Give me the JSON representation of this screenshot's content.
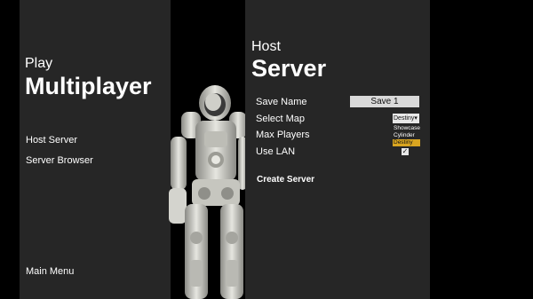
{
  "play_menu": {
    "eyebrow": "Play",
    "title": "Multiplayer",
    "items": [
      {
        "label": "Host Server"
      },
      {
        "label": "Server Browser"
      }
    ],
    "main_menu_label": "Main Menu"
  },
  "host_panel": {
    "eyebrow": "Host",
    "title": "Server",
    "settings": {
      "save_name_label": "Save Name",
      "save_name_value": "Save 1",
      "select_map_label": "Select Map",
      "select_map_value": "Destiny",
      "map_options": [
        "Showcase",
        "Cylinder",
        "Destiny"
      ],
      "max_players_label": "Max Players",
      "use_lan_label": "Use LAN",
      "use_lan_checked": true
    },
    "create_label": "Create Server"
  },
  "colors": {
    "panel_bg": "#262626",
    "selected_option": "#d9a520"
  },
  "icons": {
    "dropdown": "chevron-down-icon",
    "checkbox": "check-icon"
  }
}
